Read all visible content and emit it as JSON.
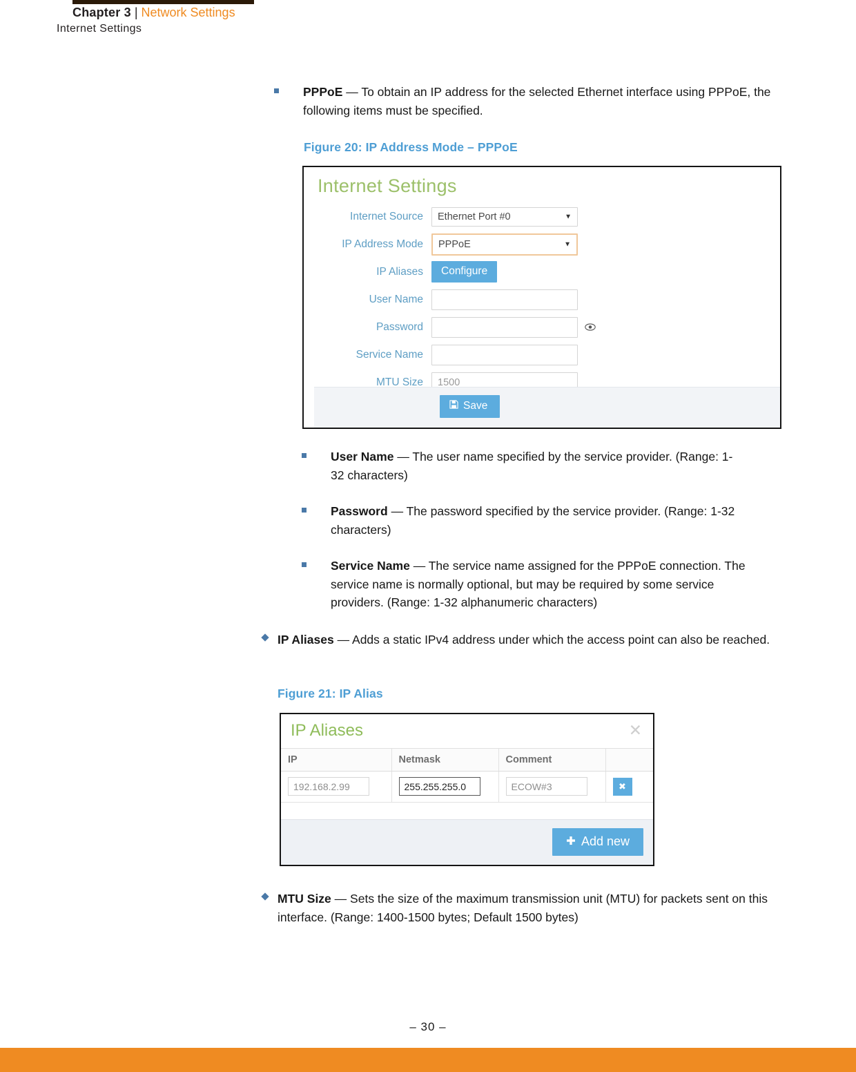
{
  "header": {
    "chapter": "Chapter 3",
    "separator": "|",
    "section": "Network Settings",
    "subsection": "Internet Settings"
  },
  "body": {
    "pppoe_bullet": {
      "term": "PPPoE",
      "dash": "—",
      "text": "To obtain an IP address for the selected Ethernet interface using PPPoE, the following items must be specified."
    },
    "figure20_caption": "Figure 20:  IP Address Mode – PPPoE",
    "username_bullet": {
      "term": "User Name",
      "dash": "—",
      "text": "The user name specified by the service provider. (Range: 1-32 characters)"
    },
    "password_bullet": {
      "term": "Password",
      "dash": "—",
      "text": "The password specified by the service provider. (Range: 1-32 characters)"
    },
    "servicename_bullet": {
      "term": "Service Name",
      "dash": "—",
      "text": "The service name assigned for the PPPoE connection. The service name is normally optional, but may be required by some service providers. (Range: 1-32 alphanumeric characters)"
    },
    "ipaliases_bullet": {
      "term": "IP Aliases",
      "dash": "—",
      "text": "Adds a static IPv4 address under which the access point can also be reached."
    },
    "figure21_caption": "Figure 21:  IP Alias",
    "mtu_bullet": {
      "term": "MTU Size",
      "dash": "—",
      "text": "Sets the size of the maximum transmission unit (MTU) for packets sent on this interface. (Range: 1400-1500 bytes; Default 1500 bytes)"
    }
  },
  "figure20": {
    "panel_title": "Internet Settings",
    "fields": [
      {
        "label": "Internet Source",
        "value": "Ethernet Port #0",
        "type": "select"
      },
      {
        "label": "IP Address Mode",
        "value": "PPPoE",
        "type": "select-focused"
      },
      {
        "label": "IP Aliases",
        "value": "Configure",
        "type": "button"
      },
      {
        "label": "User Name",
        "value": "",
        "type": "text"
      },
      {
        "label": "Password",
        "value": "",
        "type": "password"
      },
      {
        "label": "Service Name",
        "value": "",
        "type": "text"
      },
      {
        "label": "MTU Size",
        "value": "1500",
        "type": "text-placeholder"
      }
    ],
    "save_label": "Save",
    "save_icon": "floppy-disk-icon",
    "eye_icon": "eye-icon",
    "accent_blue": "#5cacde",
    "title_green": "#9cc06a",
    "label_blue": "#5e9ec4",
    "focus_border": "#f0c79a"
  },
  "figure21": {
    "dialog_title": "IP Aliases",
    "close_icon": "close-icon",
    "columns": [
      "IP",
      "Netmask",
      "Comment",
      ""
    ],
    "rows": [
      {
        "ip": "192.168.2.99",
        "netmask": "255.255.255.0",
        "comment": "ECOW#3",
        "delete_label": "✖"
      }
    ],
    "add_new_label": "Add new",
    "add_new_icon": "plus-icon",
    "accent_blue": "#5cacde",
    "title_green": "#8fbc5a"
  },
  "footer": {
    "page_number": "–  30  –",
    "bar_color": "#ef8b22"
  }
}
